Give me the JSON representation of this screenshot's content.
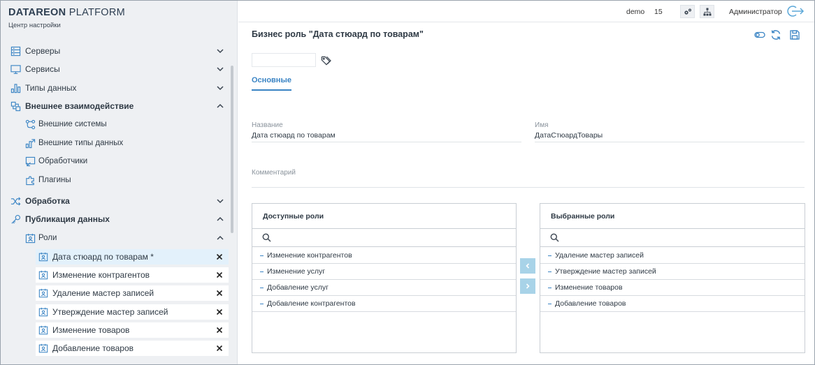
{
  "brand": {
    "name_bold": "DATAREON",
    "name_light": "PLATFORM",
    "subtitle": "Центр настройки"
  },
  "sidebar": {
    "items": [
      {
        "label": "Серверы",
        "icon": "servers-icon",
        "expanded": false
      },
      {
        "label": "Сервисы",
        "icon": "monitor-icon",
        "expanded": false
      },
      {
        "label": "Типы данных",
        "icon": "data-types-icon",
        "expanded": false
      },
      {
        "label": "Внешнее взаимодействие",
        "icon": "external-interaction-icon",
        "expanded": true,
        "children": [
          {
            "label": "Внешние системы",
            "icon": "external-systems-icon"
          },
          {
            "label": "Внешние типы данных",
            "icon": "external-data-types-icon"
          },
          {
            "label": "Обработчики",
            "icon": "handlers-icon"
          },
          {
            "label": "Плагины",
            "icon": "plugins-icon"
          }
        ]
      },
      {
        "label": "Обработка",
        "icon": "shuffle-icon",
        "expanded": false
      },
      {
        "label": "Публикация данных",
        "icon": "key-icon",
        "expanded": true
      },
      {
        "label": "Роли",
        "icon": "roles-icon",
        "expanded": true
      }
    ],
    "open_roles": [
      {
        "label": "Дата стюард по товарам *",
        "active": true
      },
      {
        "label": "Изменение контрагентов",
        "active": false
      },
      {
        "label": "Удаление мастер записей",
        "active": false
      },
      {
        "label": "Утверждение мастер записей",
        "active": false
      },
      {
        "label": "Изменение товаров",
        "active": false
      },
      {
        "label": "Добавление товаров",
        "active": false
      }
    ]
  },
  "topbar": {
    "user": "demo",
    "number": "15",
    "admin": "Администратор"
  },
  "page": {
    "title": "Бизнес роль \"Дата стюард по товарам\"",
    "tab": "Основные",
    "fields": {
      "name_label": "Название",
      "name_value": "Дата стюард по товарам",
      "id_label": "Имя",
      "id_value": "ДатаСтюардТовары",
      "comment_label": "Комментарий",
      "comment_value": ""
    }
  },
  "available_roles": {
    "title": "Доступные роли",
    "items": [
      "Изменение контрагентов",
      "Изменение услуг",
      "Добавление услуг",
      "Добавление контрагентов"
    ]
  },
  "selected_roles": {
    "title": "Выбранные роли",
    "items": [
      "Удаление мастер записей",
      "Утверждение мастер записей",
      "Изменение товаров",
      "Добавление товаров"
    ]
  },
  "colors": {
    "accent": "#3a84c4",
    "sidebar_bg": "#eef0f3",
    "active_item_bg": "#e3f1fb",
    "move_button": "#a8d3e8"
  }
}
